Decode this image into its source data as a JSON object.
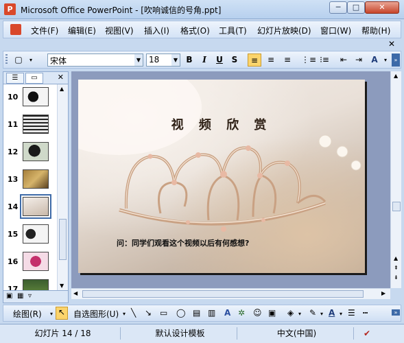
{
  "window": {
    "title": "Microsoft Office PowerPoint - [吹响诚信的号角.ppt]",
    "app_icon": "powerpoint-icon",
    "controls": {
      "minimize": "─",
      "maximize": "□",
      "close": "✕"
    }
  },
  "menubar": {
    "items": [
      {
        "label": "文件(F)"
      },
      {
        "label": "编辑(E)"
      },
      {
        "label": "视图(V)"
      },
      {
        "label": "插入(I)"
      },
      {
        "label": "格式(O)"
      },
      {
        "label": "工具(T)"
      },
      {
        "label": "幻灯片放映(D)"
      },
      {
        "label": "窗口(W)"
      },
      {
        "label": "帮助(H)"
      }
    ],
    "close": "✕"
  },
  "toolbar": {
    "font_name": "宋体",
    "font_size": "18",
    "bold": "B",
    "italic": "I",
    "underline": "U",
    "shadow": "S",
    "grow_font": "A"
  },
  "left_panel": {
    "close": "✕",
    "slides": [
      {
        "number": "10"
      },
      {
        "number": "11"
      },
      {
        "number": "12"
      },
      {
        "number": "13"
      },
      {
        "number": "14",
        "selected": true
      },
      {
        "number": "15"
      },
      {
        "number": "16"
      },
      {
        "number": "17"
      }
    ]
  },
  "slide": {
    "title": "视 频 欣 赏",
    "question": "问：同学们观看这个视频以后有何感想?"
  },
  "drawbar": {
    "draw_menu": "绘图(R)",
    "autoshapes": "自选图形(U)"
  },
  "statusbar": {
    "slide_info": "幻灯片 14 / 18",
    "template": "默认设计模板",
    "language": "中文(中国)"
  },
  "colors": {
    "accent": "#fbd46c",
    "frame": "#c7d9ef",
    "slide_bg": "#8c9bbd"
  }
}
